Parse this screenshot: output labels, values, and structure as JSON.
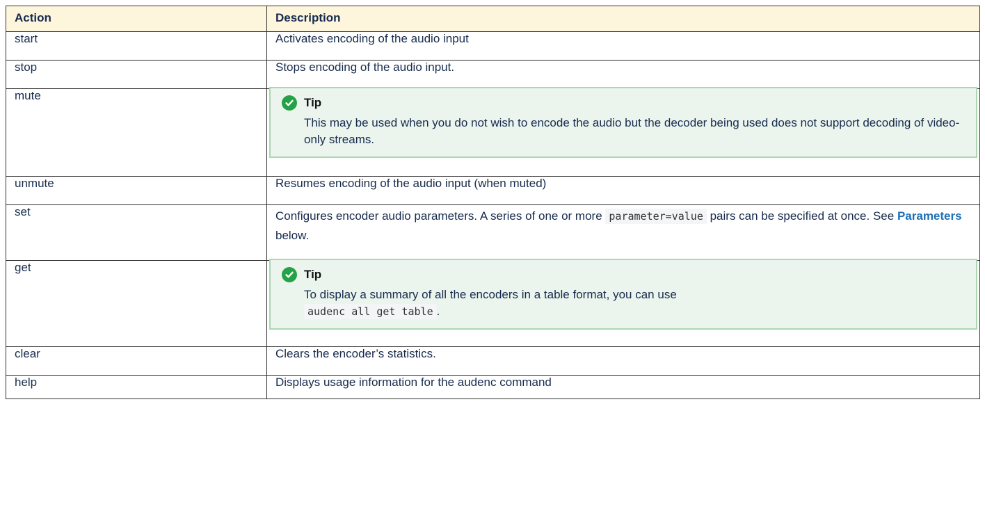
{
  "headers": {
    "action": "Action",
    "description": "Description"
  },
  "rows": {
    "start": {
      "action": "start",
      "description": "Activates encoding of the audio input"
    },
    "stop": {
      "action": "stop",
      "description": "Stops encoding of the audio input."
    },
    "mute": {
      "action": "mute",
      "tip_title": "Tip",
      "tip_text": "This may be used when you do not wish to encode the audio but the decoder being used does not support decoding of video-only streams."
    },
    "unmute": {
      "action": "unmute",
      "description": "Resumes encoding of the audio input (when muted)"
    },
    "set": {
      "action": "set",
      "desc_part1": "Configures encoder audio parameters. A series of one or more",
      "code": "parameter=value",
      "desc_part2": "pairs can be specified at once. See",
      "link": "Parameters",
      "desc_part3": "below."
    },
    "get": {
      "action": "get",
      "tip_title": "Tip",
      "tip_text": "To display a summary of all the encoders in a table format, you can use",
      "code": "audenc all get table",
      "tip_end": "."
    },
    "clear": {
      "action": "clear",
      "description": "Clears the encoder’s statistics."
    },
    "help": {
      "action": "help",
      "description": "Displays usage information for the audenc command"
    }
  },
  "colors": {
    "header_bg": "#fdf5dc",
    "tip_bg": "#ebf5ee",
    "tip_border": "#abd8b2",
    "tip_icon": "#24a248",
    "link": "#1d6fb6"
  },
  "icons": {
    "tip": "check-circle-icon"
  }
}
